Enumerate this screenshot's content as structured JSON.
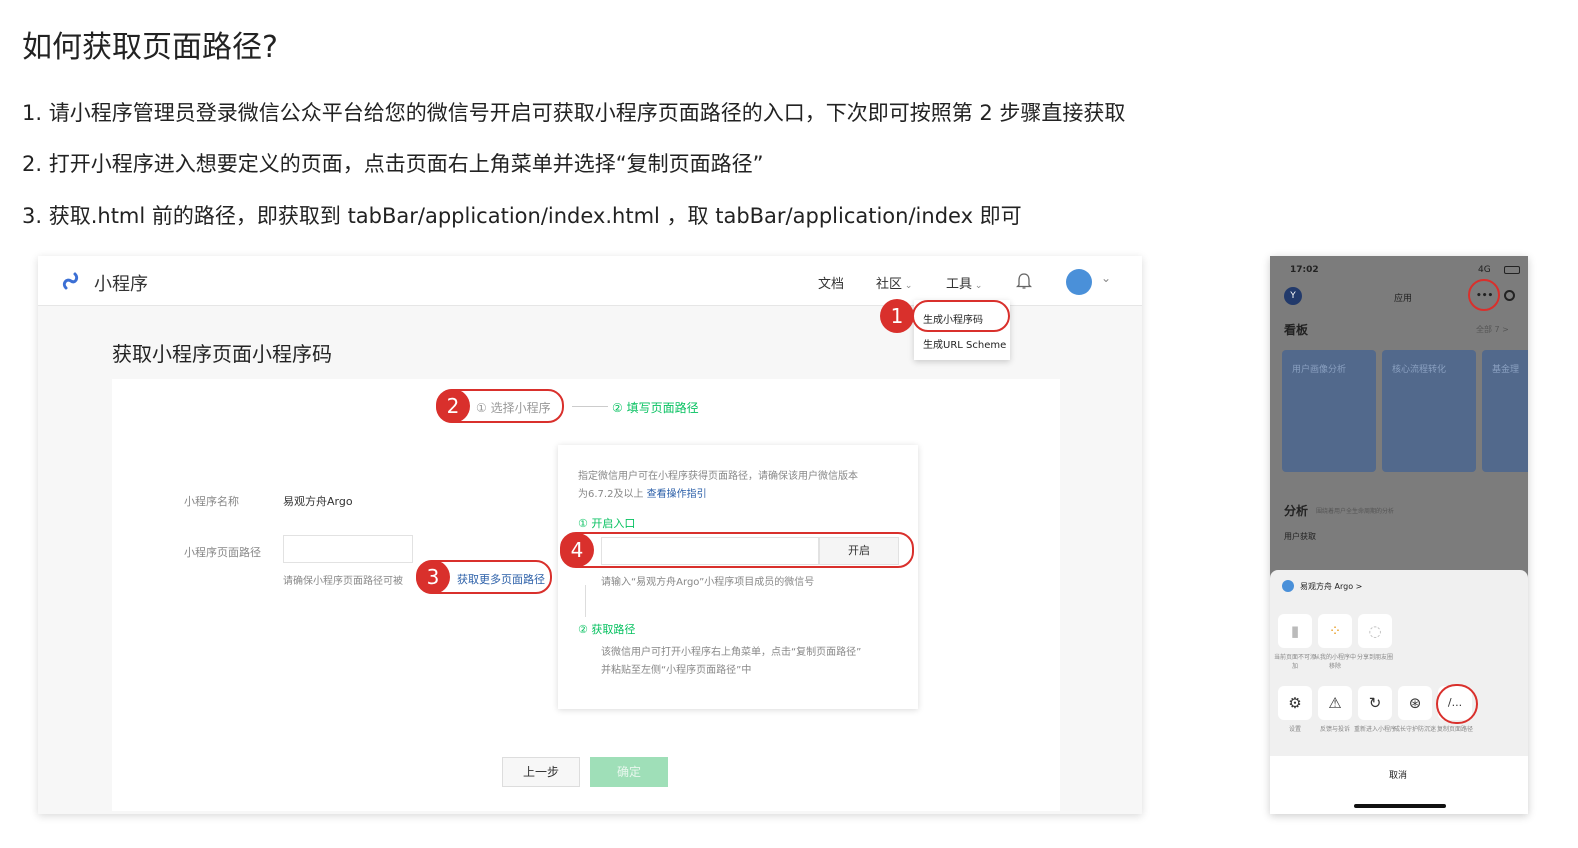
{
  "doc": {
    "title": "如何获取页面路径?",
    "steps": [
      "1. 请小程序管理员登录微信公众平台给您的微信号开启可获取小程序页面路径的入口，下次即可按照第 2 步骤直接获取",
      "2. 打开小程序进入想要定义的页面，点击页面右上角菜单并选择“复制页面路径”",
      "3. 获取.html 前的路径，即获取到 tabBar/application/index.html ，取 tabBar/application/index 即可"
    ]
  },
  "console": {
    "brand": "小程序",
    "nav": [
      "文档",
      "社区",
      "工具"
    ],
    "dropdown": [
      "生成小程序码",
      "生成URL Scheme"
    ],
    "page_title": "获取小程序页面小程序码",
    "stepper": [
      "① 选择小程序",
      "② 填写页面路径"
    ],
    "form": {
      "name_label": "小程序名称",
      "name_value": "易观方舟Argo",
      "path_label": "小程序页面路径",
      "path_hint": "请确保小程序页面路径可被",
      "more_link": "获取更多页面路径"
    },
    "panel": {
      "line1": "指定微信用户可在小程序获得页面路径，请确保该用户微信版本",
      "line2": "为6.7.2及以上",
      "line2_link": "查看操作指引",
      "step1_title": "① 开启入口",
      "open_button": "开启",
      "input_hint": "请输入“易观方舟Argo”小程序项目成员的微信号",
      "step2_title": "② 获取路径",
      "step2_desc1": "该微信用户可打开小程序右上角菜单，点击“复制页面路径”",
      "step2_desc2": "并粘贴至左侧“小程序页面路径”中"
    },
    "buttons": {
      "prev": "上一步",
      "confirm": "确定"
    }
  },
  "badges": [
    "1",
    "2",
    "3",
    "4"
  ],
  "phone": {
    "time": "17:02",
    "signal": "4G",
    "avatar_letter": "Y",
    "header_title": "应用",
    "more_glyph": "•••",
    "board_title": "看板",
    "board_all": "全部 7 >",
    "tiles": [
      "用户画像分析",
      "核心流程转化",
      "基金理"
    ],
    "analysis_title": "分析",
    "analysis_sub": "围绕着用户全生命周期的分析",
    "user_get": "用户获取",
    "sheet_app": "易观方舟 Argo >",
    "row1_labels": [
      "当前页面不可添加",
      "从我的小程序中移除",
      "分享到朋友圈"
    ],
    "row2_labels": [
      "设置",
      "反馈与投诉",
      "重新进入小程序",
      "成长守护防沉迷",
      "复制页面路径"
    ],
    "copy_glyph": "/...",
    "cancel": "取消"
  },
  "colors": {
    "accent_red": "#d9302c",
    "wechat_green": "#07c160",
    "link_blue": "#2b5fa8"
  }
}
